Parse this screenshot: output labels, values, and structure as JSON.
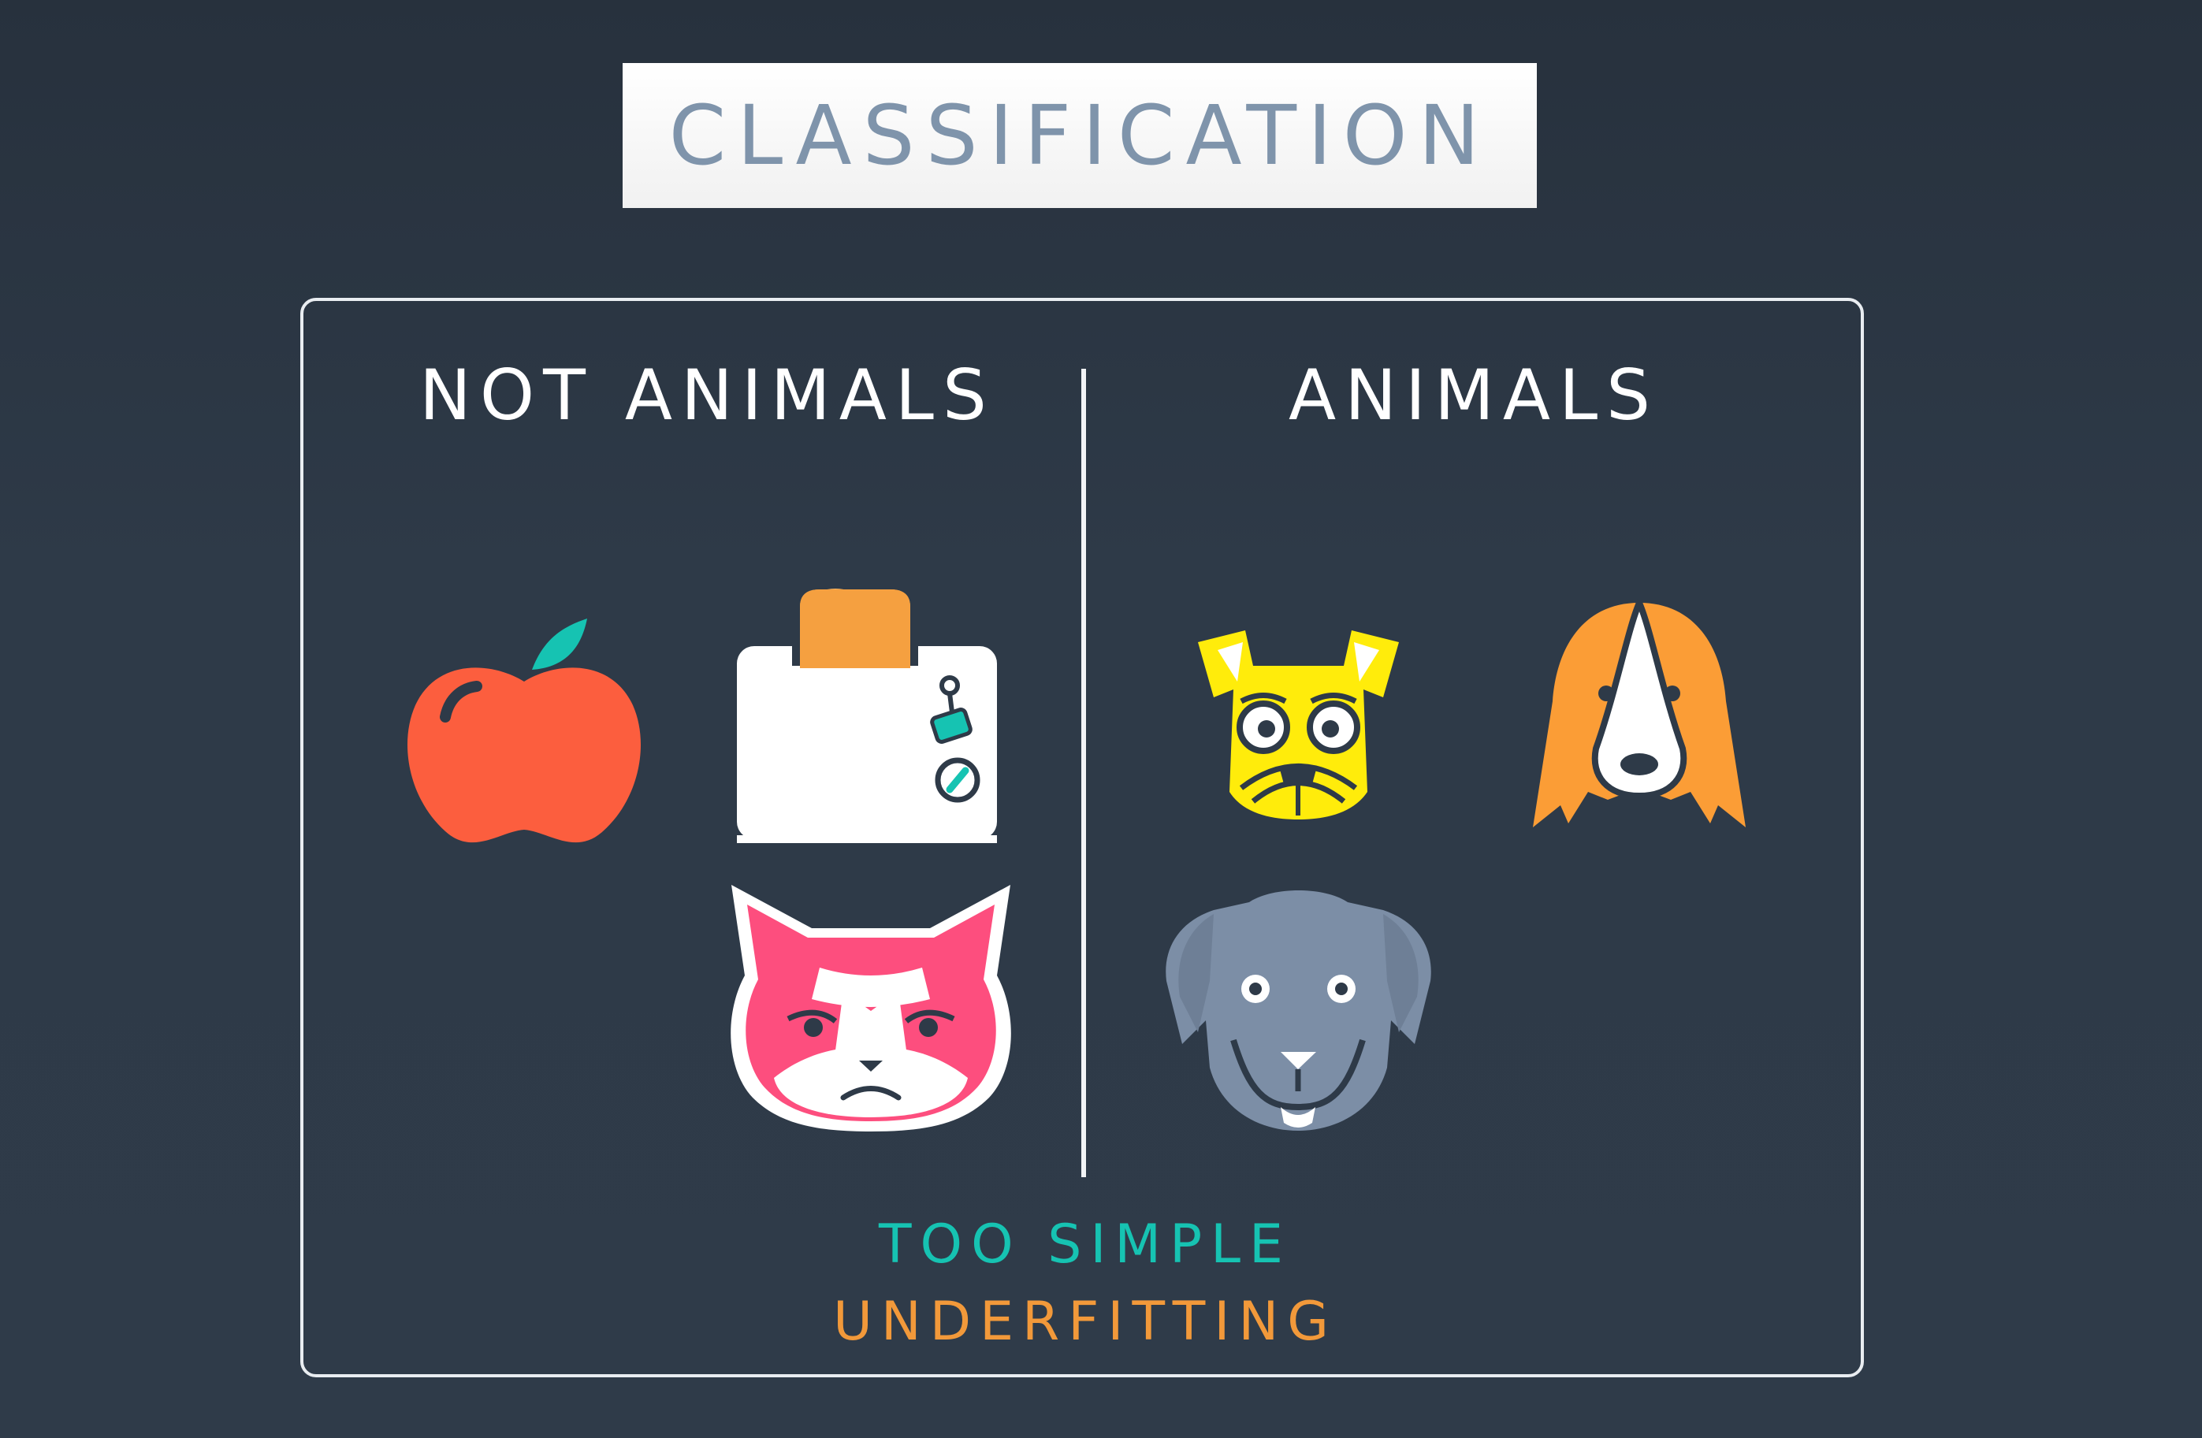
{
  "title": "CLASSIFICATION",
  "groups": {
    "not_animals": {
      "label": "NOT ANIMALS",
      "items": [
        "apple-icon",
        "toaster-icon",
        "grumpy-cat-icon"
      ]
    },
    "animals": {
      "label": "ANIMALS",
      "items": [
        "terrier-dog-icon",
        "spaniel-dog-icon",
        "labrador-dog-icon"
      ]
    }
  },
  "captions": {
    "line1": "TOO SIMPLE",
    "line2": "UNDERFITTING"
  },
  "colors": {
    "background": "#2e3a48",
    "title_text": "#7f94ab",
    "caption_line1": "#16c3b2",
    "caption_line2": "#f2993a",
    "apple": "#fc5e3e",
    "toast": "#f5a040",
    "cat": "#fd4e7e",
    "terrier": "#ffec0b",
    "spaniel": "#fb9d36",
    "labrador": "#7c8ea6"
  }
}
